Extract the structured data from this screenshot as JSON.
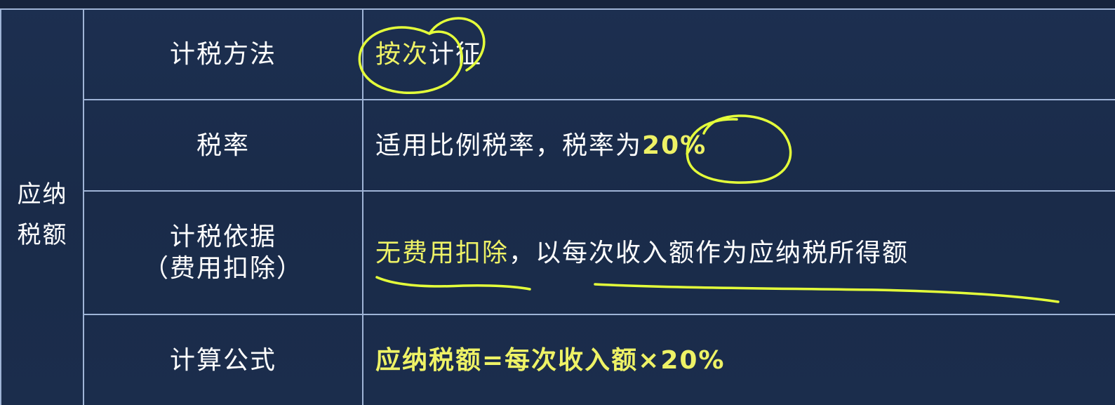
{
  "side_label": {
    "line1": "应纳",
    "line2": "税额"
  },
  "rows": {
    "method": {
      "label": "计税方法",
      "value_highlight": "按次",
      "value_rest": "计征"
    },
    "rate": {
      "label": "税率",
      "value_prefix": "适用比例税率，税率为",
      "value_highlight": "20%"
    },
    "basis": {
      "label_line1": "计税依据",
      "label_line2": "（费用扣除）",
      "value_highlight": "无费用扣除",
      "value_rest": "，以每次收入额作为应纳税所得额"
    },
    "formula": {
      "label": "计算公式",
      "value": "应纳税额=每次收入额×20%"
    }
  },
  "colors": {
    "background": "#1a2c4a",
    "grid": "#9fb4d6",
    "text": "#ffffff",
    "highlight": "#eef266",
    "annotation": "#e4ff3a"
  }
}
